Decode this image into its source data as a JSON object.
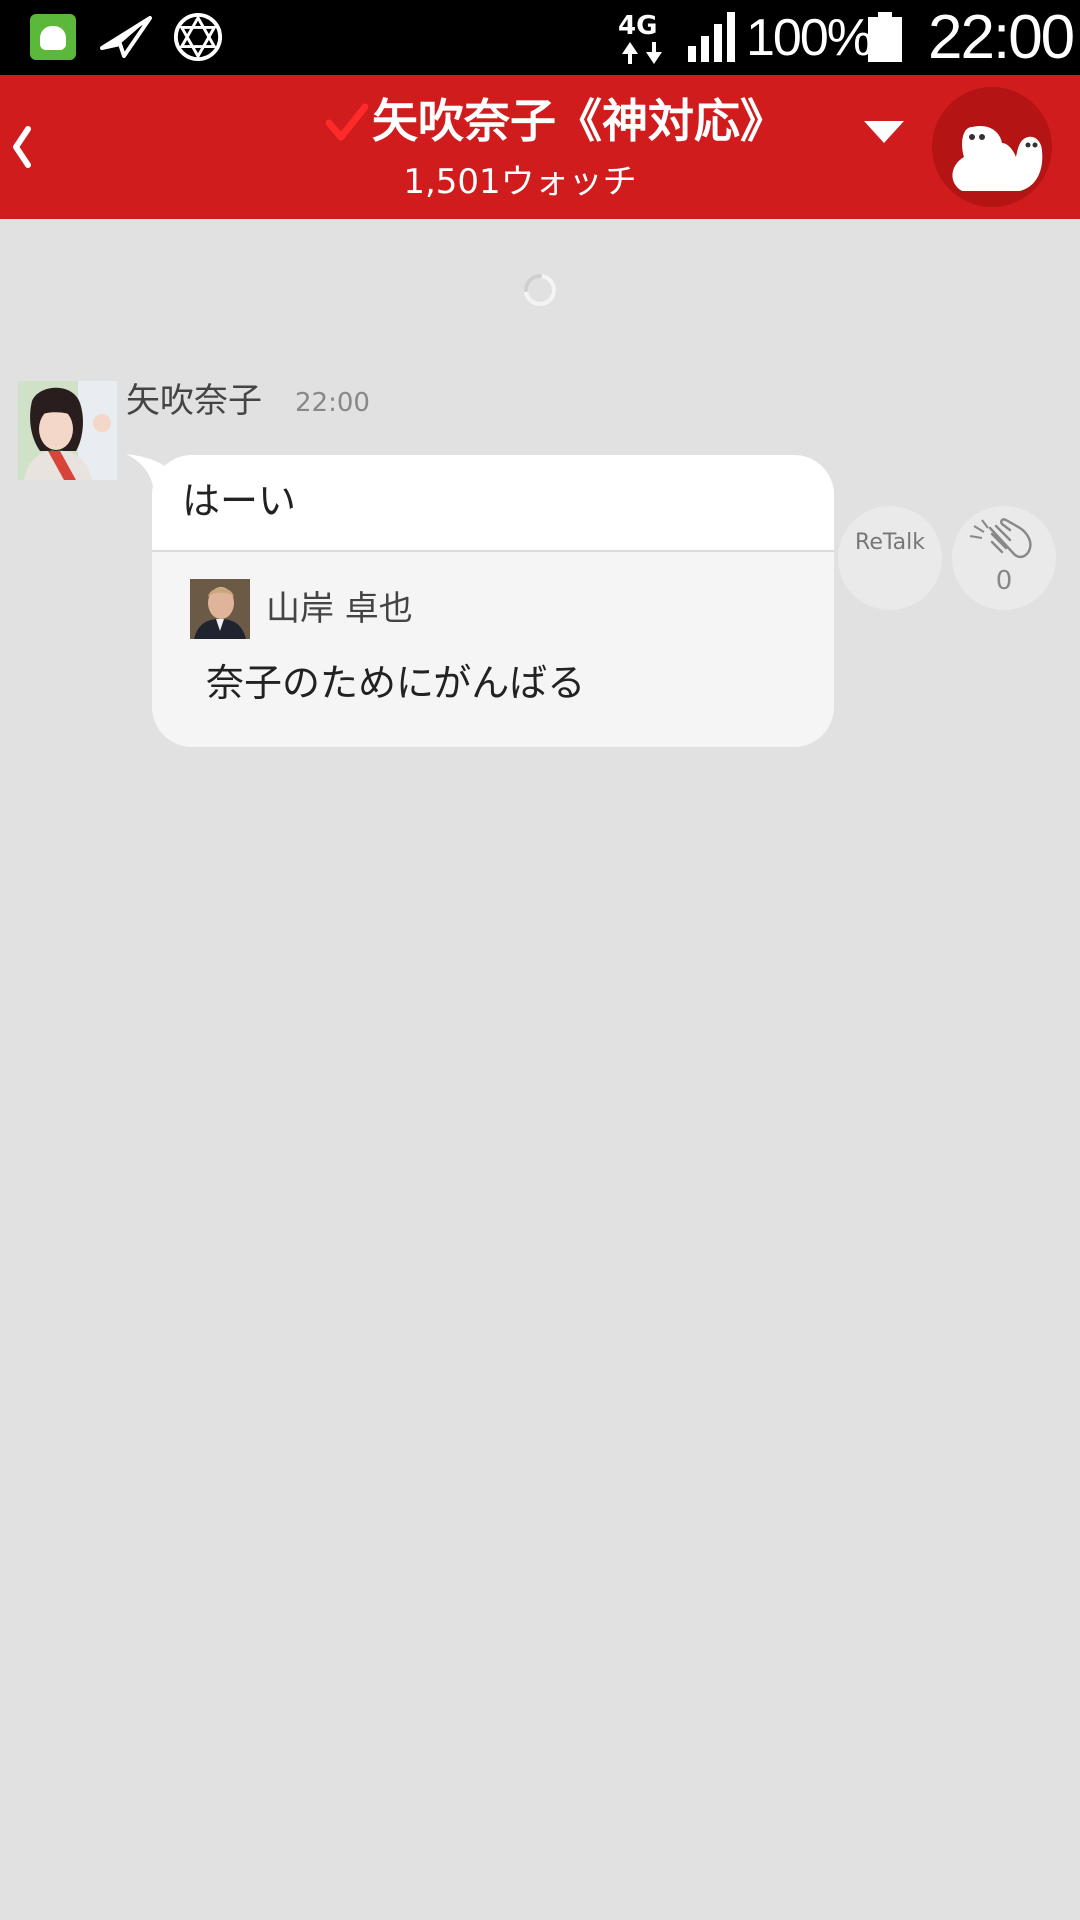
{
  "status_bar": {
    "network": "4G",
    "battery_percent": "100%",
    "time": "22:00",
    "icons": [
      "app-notification-icon",
      "paper-plane-icon",
      "hexagram-icon",
      "4g-data-icon",
      "signal-icon",
      "battery-icon"
    ]
  },
  "header": {
    "title": "矢吹奈子《神対応》",
    "watch_count": "1,501ウォッチ",
    "accent_color": "#d01c1c",
    "icons": [
      "back-icon",
      "verified-check-icon",
      "dropdown-icon",
      "mascot-icon"
    ]
  },
  "messages": [
    {
      "sender": "矢吹奈子",
      "time": "22:00",
      "text": "はーい",
      "quote": {
        "name": "山岸 卓也",
        "text": "奈子のためにがんばる"
      },
      "actions": {
        "retalk_label": "ReTalk",
        "clap_count": "0"
      }
    }
  ]
}
